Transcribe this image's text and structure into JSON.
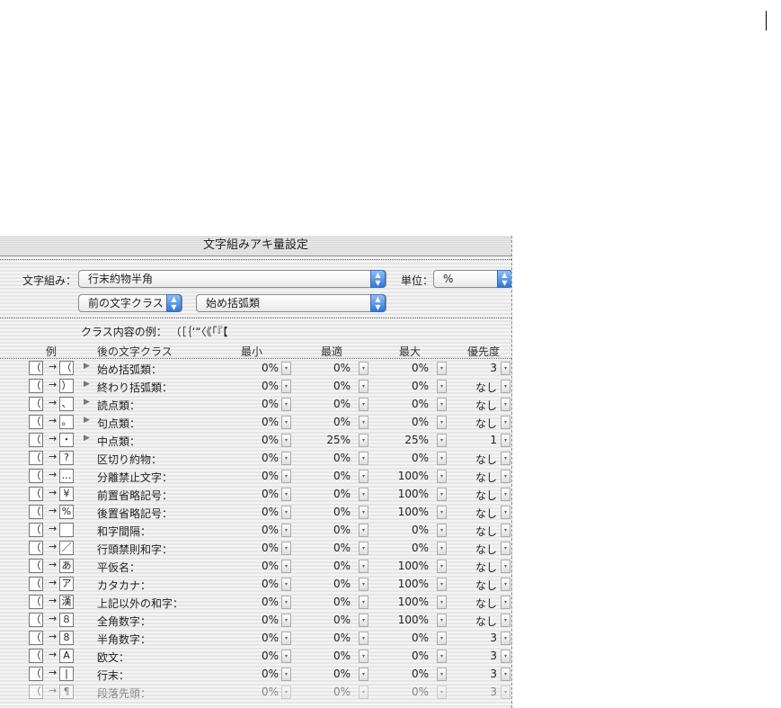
{
  "dialog": {
    "title": "文字組みアキ量設定",
    "mojikumi_label": "文字組み：",
    "mojikumi_value": "行末約物半角",
    "unit_label": "単位：",
    "unit_value": "%",
    "prev_class": "前の文字クラス",
    "class_value": "始め括弧類",
    "class_example_label": "クラス内容の例：",
    "class_example_chars": "（［｛‘“〈《「『【"
  },
  "columns": [
    "例",
    "後の文字クラス",
    "最小",
    "最適",
    "最大",
    "優先度"
  ],
  "rows": [
    {
      "g2": "（",
      "name": "始め括弧類：",
      "min": "0%",
      "opt": "0%",
      "max": "0%",
      "pri": "3",
      "expand": true
    },
    {
      "g2": "）",
      "name": "終わり括弧類：",
      "min": "0%",
      "opt": "0%",
      "max": "0%",
      "pri": "なし",
      "expand": true
    },
    {
      "g2": "、",
      "name": "読点類：",
      "min": "0%",
      "opt": "0%",
      "max": "0%",
      "pri": "なし",
      "expand": true
    },
    {
      "g2": "。",
      "name": "句点類：",
      "min": "0%",
      "opt": "0%",
      "max": "0%",
      "pri": "なし",
      "expand": true
    },
    {
      "g2": "・",
      "name": "中点類：",
      "min": "0%",
      "opt": "25%",
      "max": "25%",
      "pri": "1",
      "expand": true
    },
    {
      "g2": "?",
      "name": "区切り約物：",
      "min": "0%",
      "opt": "0%",
      "max": "0%",
      "pri": "なし"
    },
    {
      "g2": "…",
      "name": "分離禁止文字：",
      "min": "0%",
      "opt": "0%",
      "max": "100%",
      "pri": "なし"
    },
    {
      "g2": "¥",
      "name": "前置省略記号：",
      "min": "0%",
      "opt": "0%",
      "max": "100%",
      "pri": "なし"
    },
    {
      "g2": "%",
      "name": "後置省略記号：",
      "min": "0%",
      "opt": "0%",
      "max": "100%",
      "pri": "なし"
    },
    {
      "g2": " ",
      "name": "和字間隔：",
      "min": "0%",
      "opt": "0%",
      "max": "0%",
      "pri": "なし"
    },
    {
      "g2": "／",
      "name": "行頭禁則和字：",
      "min": "0%",
      "opt": "0%",
      "max": "0%",
      "pri": "なし"
    },
    {
      "g2": "あ",
      "name": "平仮名：",
      "min": "0%",
      "opt": "0%",
      "max": "100%",
      "pri": "なし"
    },
    {
      "g2": "ア",
      "name": "カタカナ：",
      "min": "0%",
      "opt": "0%",
      "max": "100%",
      "pri": "なし"
    },
    {
      "g2": "漢",
      "name": "上記以外の和字：",
      "min": "0%",
      "opt": "0%",
      "max": "100%",
      "pri": "なし"
    },
    {
      "g2": "８",
      "name": "全角数字：",
      "min": "0%",
      "opt": "0%",
      "max": "100%",
      "pri": "なし"
    },
    {
      "g2": "8",
      "name": "半角数字：",
      "min": "0%",
      "opt": "0%",
      "max": "0%",
      "pri": "3"
    },
    {
      "g2": "A",
      "name": "欧文：",
      "min": "0%",
      "opt": "0%",
      "max": "0%",
      "pri": "3"
    },
    {
      "g2": "|",
      "name": "行末：",
      "min": "0%",
      "opt": "0%",
      "max": "0%",
      "pri": "3"
    },
    {
      "g2": "¶",
      "name": "段落先頭：",
      "min": "0%",
      "opt": "0%",
      "max": "0%",
      "pri": "3",
      "dim": true
    }
  ],
  "example_prefix_glyph": "（",
  "example_arrow": "→",
  "expand_glyph": "▶",
  "stepper_glyph": "▾",
  "accent_color": "#2f76d6"
}
